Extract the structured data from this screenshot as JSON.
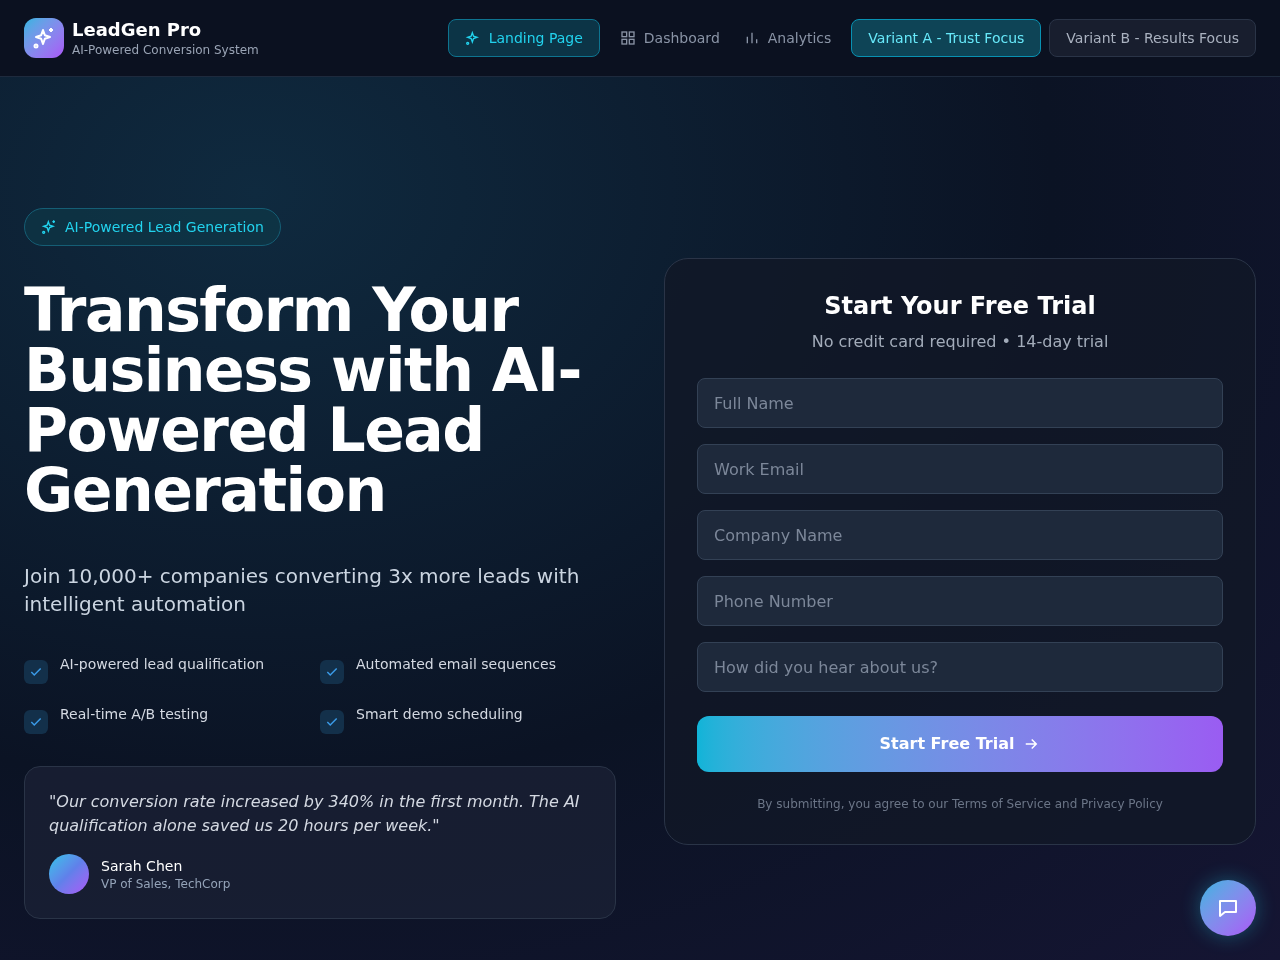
{
  "brand": {
    "name": "LeadGen Pro",
    "tagline": "AI-Powered Conversion System"
  },
  "nav": [
    {
      "label": "Landing Page",
      "kind": "sparkle",
      "selected": true
    },
    {
      "label": "Dashboard",
      "kind": "grid",
      "selected": false
    },
    {
      "label": "Analytics",
      "kind": "bars",
      "selected": false
    }
  ],
  "variants": [
    {
      "label": "Variant A - Trust Focus",
      "selected": true
    },
    {
      "label": "Variant B - Results Focus",
      "selected": false
    }
  ],
  "hero": {
    "badge": "AI-Powered Lead Generation",
    "title": "Transform Your Business with AI-Powered Lead Generation",
    "subtitle": "Join 10,000+ companies converting 3x more leads with intelligent automation",
    "features": [
      "AI-powered lead qualification",
      "Automated email sequences",
      "Real-time A/B testing",
      "Smart demo scheduling"
    ],
    "testimonial": {
      "quote": "\"Our conversion rate increased by 340% in the first month. The AI qualification alone saved us 20 hours per week.\"",
      "name": "Sarah Chen",
      "role": "VP of Sales, TechCorp"
    }
  },
  "form": {
    "title": "Start Your Free Trial",
    "subtitle": "No credit card required • 14-day trial",
    "fields": [
      {
        "placeholder": "Full Name"
      },
      {
        "placeholder": "Work Email"
      },
      {
        "placeholder": "Company Name"
      },
      {
        "placeholder": "Phone Number"
      },
      {
        "placeholder": "How did you hear about us?"
      }
    ],
    "submit": "Start Free Trial",
    "legal": "By submitting, you agree to our Terms of Service and Privacy Policy"
  }
}
